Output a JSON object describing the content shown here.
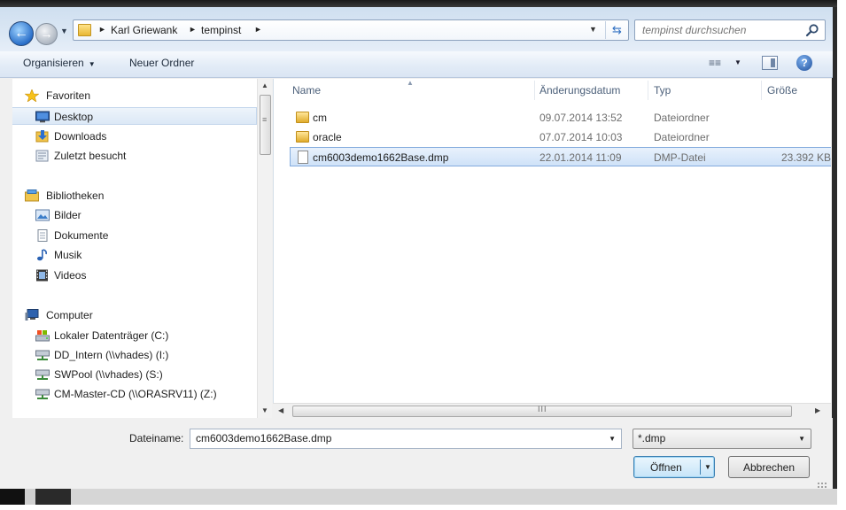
{
  "address": {
    "breadcrumbs": [
      "Karl Griewank",
      "tempinst"
    ],
    "search_placeholder": "tempinst durchsuchen"
  },
  "toolbar": {
    "organise_label": "Organisieren",
    "new_folder_label": "Neuer Ordner"
  },
  "navigation": {
    "favorites": {
      "label": "Favoriten",
      "items": [
        {
          "label": "Desktop",
          "icon": "desktop-icon",
          "selected": true
        },
        {
          "label": "Downloads",
          "icon": "downloads-icon"
        },
        {
          "label": "Zuletzt besucht",
          "icon": "recent-places-icon"
        }
      ]
    },
    "libraries": {
      "label": "Bibliotheken",
      "items": [
        {
          "label": "Bilder",
          "icon": "pictures-icon"
        },
        {
          "label": "Dokumente",
          "icon": "documents-icon"
        },
        {
          "label": "Musik",
          "icon": "music-icon"
        },
        {
          "label": "Videos",
          "icon": "videos-icon"
        }
      ]
    },
    "computer": {
      "label": "Computer",
      "items": [
        {
          "label": "Lokaler Datenträger (C:)",
          "icon": "local-drive-icon"
        },
        {
          "label": "DD_Intern (\\\\vhades) (I:)",
          "icon": "network-drive-icon"
        },
        {
          "label": "SWPool (\\\\vhades) (S:)",
          "icon": "network-drive-icon"
        },
        {
          "label": "CM-Master-CD (\\\\ORASRV11) (Z:)",
          "icon": "network-drive-icon"
        }
      ]
    }
  },
  "file_list": {
    "columns": [
      "Name",
      "Änderungsdatum",
      "Typ",
      "Größe"
    ],
    "rows": [
      {
        "name": "cm",
        "date": "09.07.2014 13:52",
        "type": "Dateiordner",
        "size": "",
        "kind": "folder"
      },
      {
        "name": "oracle",
        "date": "07.07.2014 10:03",
        "type": "Dateiordner",
        "size": "",
        "kind": "folder"
      },
      {
        "name": "cm6003demo1662Base.dmp",
        "date": "22.01.2014 11:09",
        "type": "DMP-Datei",
        "size": "23.392 KB",
        "kind": "file",
        "selected": true
      }
    ]
  },
  "form": {
    "filename_label": "Dateiname:",
    "filename_value": "cm6003demo1662Base.dmp",
    "filter_value": "*.dmp",
    "open_label": "Öffnen",
    "cancel_label": "Abbrechen"
  },
  "colors": {
    "selection_border": "#84acdd",
    "selection_fill": "#cfe2f8",
    "column_header_text": "#4c607a"
  }
}
